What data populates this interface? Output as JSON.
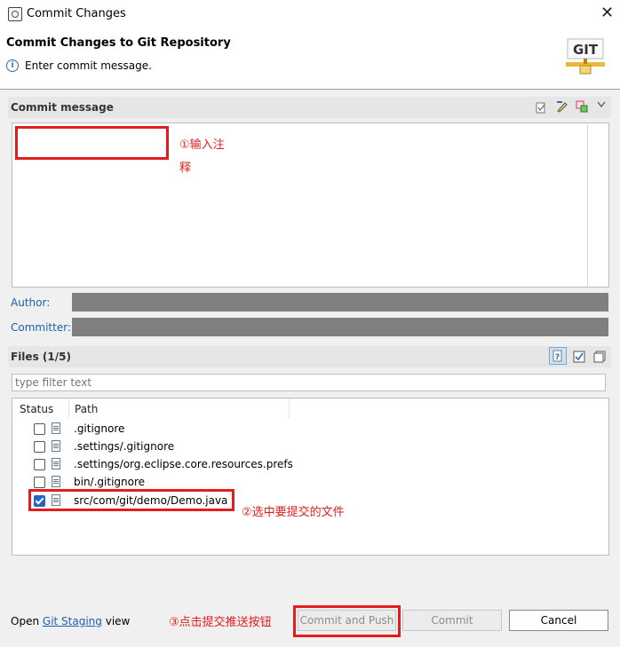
{
  "window": {
    "title": "Commit Changes",
    "close_glyph": "✕"
  },
  "header": {
    "title": "Commit Changes to Git Repository",
    "info_text": "Enter commit message.",
    "logo_text": "GIT"
  },
  "commit_message": {
    "section_title": "Commit message",
    "value": "",
    "annotation": [
      "①输入注",
      "释"
    ]
  },
  "author": {
    "label": "Author:",
    "value": ""
  },
  "committer": {
    "label": "Committer:",
    "value": ""
  },
  "files": {
    "section_title": "Files (1/5)",
    "filter_placeholder": "type filter text",
    "columns": [
      "Status",
      "Path"
    ],
    "rows": [
      {
        "path": ".gitignore",
        "checked": false
      },
      {
        "path": ".settings/.gitignore",
        "checked": false
      },
      {
        "path": ".settings/org.eclipse.core.resources.prefs",
        "checked": false
      },
      {
        "path": "bin/.gitignore",
        "checked": false
      },
      {
        "path": "src/com/git/demo/Demo.java",
        "checked": true
      }
    ],
    "annotation": "②选中要提交的文件"
  },
  "footer": {
    "open_text": "Open",
    "staging_link": "Git Staging",
    "view_text": "view",
    "annotation": "③点击提交推送按钮",
    "commit_push_label": "Commit and Push",
    "commit_label": "Commit",
    "cancel_label": "Cancel"
  },
  "colors": {
    "annotation_red": "#e21d1d",
    "link_blue": "#1a5fb4",
    "checkbox_blue": "#1e66c8"
  }
}
